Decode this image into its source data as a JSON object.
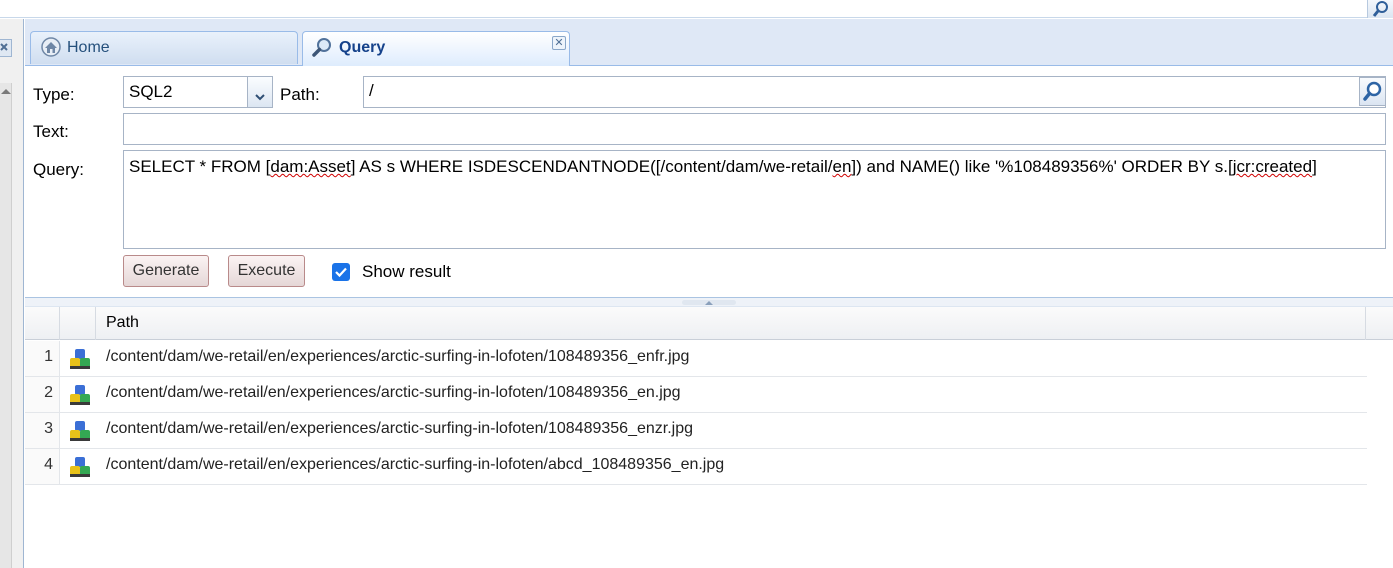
{
  "tabs": [
    {
      "label": "Home",
      "icon": "home-icon"
    },
    {
      "label": "Query",
      "icon": "search-icon",
      "closable": true
    }
  ],
  "form": {
    "type_label": "Type:",
    "type_value": "SQL2",
    "path_label": "Path:",
    "path_value": "/",
    "text_label": "Text:",
    "text_value": "",
    "query_label": "Query:",
    "query_parts": {
      "p1": "SELECT * FROM [",
      "p2": "dam:Asset",
      "p3": "] AS s WHERE ISDESCENDANTNODE([/content/dam/we-retail/",
      "p4": "en",
      "p5": "]) and NAME() like '%108489356%' ORDER BY s.[",
      "p6": "jcr:created",
      "p7": "]"
    }
  },
  "buttons": {
    "generate": "Generate",
    "execute": "Execute",
    "show_result": "Show result",
    "show_result_checked": true
  },
  "results": {
    "column_header": "Path",
    "rows": [
      {
        "num": "1",
        "path": "/content/dam/we-retail/en/experiences/arctic-surfing-in-lofoten/108489356_enfr.jpg"
      },
      {
        "num": "2",
        "path": "/content/dam/we-retail/en/experiences/arctic-surfing-in-lofoten/108489356_en.jpg"
      },
      {
        "num": "3",
        "path": "/content/dam/we-retail/en/experiences/arctic-surfing-in-lofoten/108489356_enzr.jpg"
      },
      {
        "num": "4",
        "path": "/content/dam/we-retail/en/experiences/arctic-surfing-in-lofoten/abcd_108489356_en.jpg"
      }
    ]
  },
  "colors": {
    "accent": "#1a73e8",
    "tab_text": "#15428b",
    "border": "#99bbe8"
  }
}
